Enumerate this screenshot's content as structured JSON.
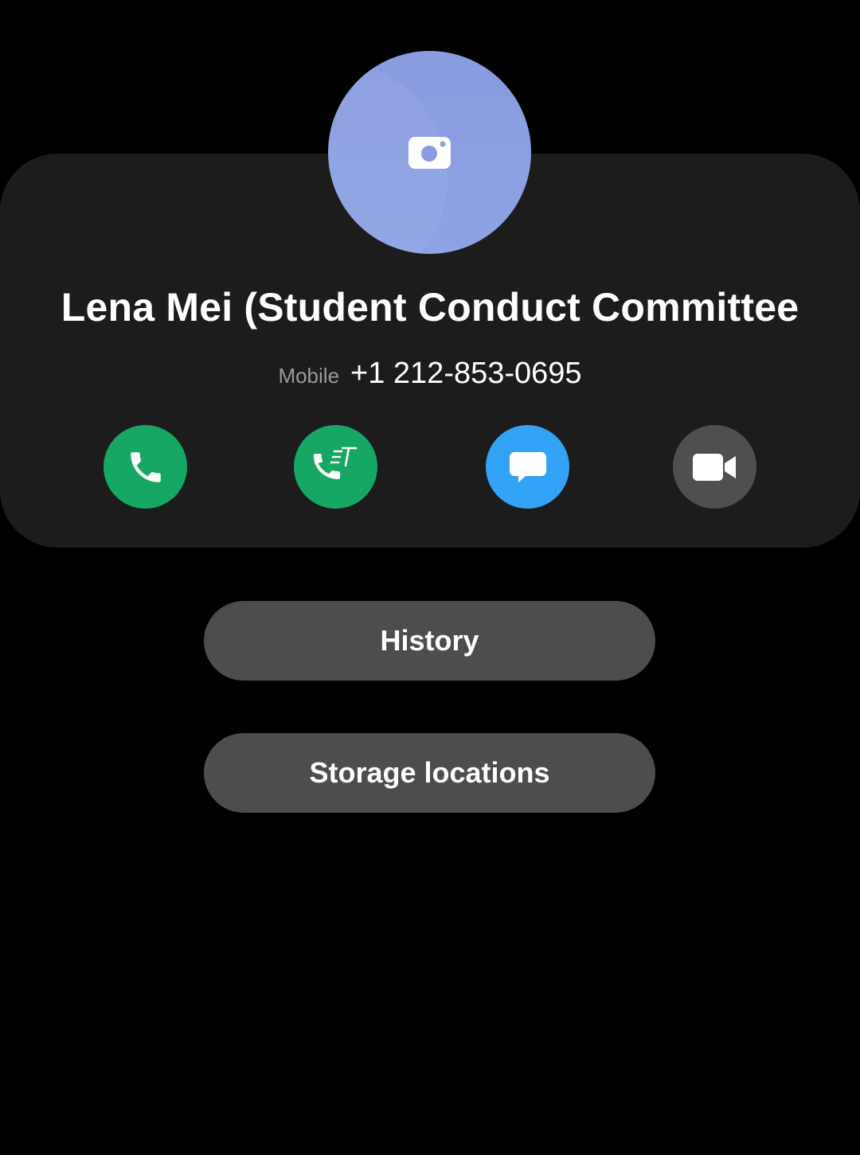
{
  "contact": {
    "name": "Lena Mei (Student Conduct Committee",
    "phone_type": "Mobile",
    "phone_number": "+1 212-853-0695",
    "avatar_color": "#8a9be0",
    "avatar_icon": "camera-icon"
  },
  "actions": [
    {
      "name": "voice-call",
      "icon": "phone-icon",
      "color": "#17a765"
    },
    {
      "name": "text-call",
      "icon": "phone-text-icon",
      "color": "#17a765"
    },
    {
      "name": "message",
      "icon": "chat-bubble-icon",
      "color": "#32a3f5"
    },
    {
      "name": "video-call",
      "icon": "video-camera-icon",
      "color": "#4f4f4f"
    }
  ],
  "buttons": {
    "history_label": "History",
    "storage_label": "Storage locations"
  }
}
